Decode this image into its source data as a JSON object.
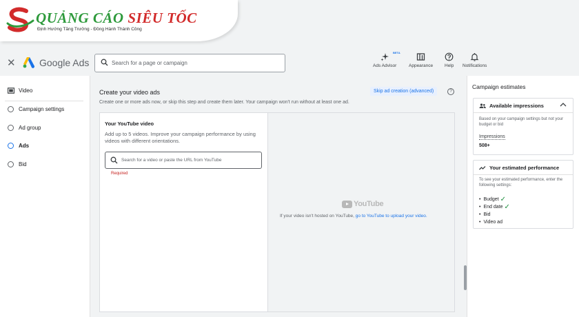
{
  "watermark": {
    "brand_part1": "QUẢNG CÁO",
    "brand_part2": "SIÊU TỐC",
    "tagline": "Định Hướng Tăng Trưởng - Đồng Hành Thành Công"
  },
  "header": {
    "app_name": "Google Ads",
    "search_placeholder": "Search for a page or campaign",
    "tools": [
      {
        "label": "Ads Advisor",
        "icon": "sparkle-icon",
        "badge": "BETA"
      },
      {
        "label": "Appearance",
        "icon": "appearance-icon"
      },
      {
        "label": "Help",
        "icon": "help-icon"
      },
      {
        "label": "Notifications",
        "icon": "bell-icon"
      }
    ]
  },
  "sidebar": {
    "items": [
      {
        "label": "Video",
        "icon": "video-icon"
      },
      {
        "label": "Campaign settings"
      },
      {
        "label": "Ad group"
      },
      {
        "label": "Ads",
        "active": true
      },
      {
        "label": "Bid"
      }
    ]
  },
  "main": {
    "title": "Create your video ads",
    "description": "Create one or more ads now, or skip this step and create them later. Your campaign won't run without at least one ad.",
    "skip_label": "Skip ad creation (advanced)",
    "youtube_card": {
      "title": "Your YouTube video",
      "description": "Add up to 5 videos. Improve your campaign performance by using videos with different orientations.",
      "input_placeholder": "Search for a video or paste the URL from YouTube",
      "required_label": "Required",
      "logo_text": "YouTube",
      "upload_prefix": "If your video isn't hosted on YouTube,",
      "upload_link": "go to YouTube to upload your video."
    }
  },
  "estimates": {
    "title": "Campaign estimates",
    "impressions": {
      "heading": "Available impressions",
      "note": "Based on your campaign settings but not your budget or bid",
      "label": "Impressions",
      "value": "508+"
    },
    "performance": {
      "heading": "Your estimated performance",
      "note": "To see your estimated performance, enter the following settings:",
      "items": [
        {
          "label": "Budget",
          "done": true
        },
        {
          "label": "End date",
          "done": true
        },
        {
          "label": "Bid",
          "done": false
        },
        {
          "label": "Video ad",
          "done": false
        }
      ]
    }
  },
  "colors": {
    "accent": "#1a73e8",
    "required": "#c5221f",
    "check": "#1e8e3e"
  }
}
